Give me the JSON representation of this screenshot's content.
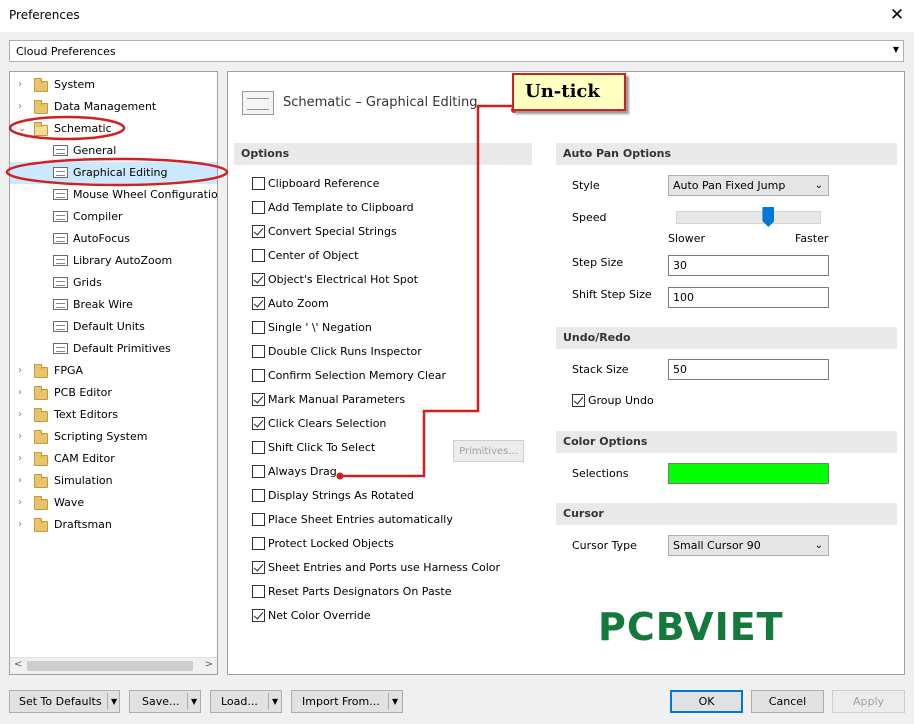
{
  "window": {
    "title": "Preferences",
    "close_glyph": "✕"
  },
  "cloud_combo": {
    "value": "Cloud Preferences"
  },
  "tree": {
    "items": [
      {
        "label": "System",
        "level": 0,
        "icon": "folder-icon",
        "expanded": false
      },
      {
        "label": "Data Management",
        "level": 0,
        "icon": "folder-icon",
        "expanded": false
      },
      {
        "label": "Schematic",
        "level": 0,
        "icon": "folder-open-icon",
        "expanded": true
      },
      {
        "label": "General",
        "level": 1,
        "icon": "page-icon"
      },
      {
        "label": "Graphical Editing",
        "level": 1,
        "icon": "page-icon",
        "selected": true
      },
      {
        "label": "Mouse Wheel Configuration",
        "level": 1,
        "icon": "page-icon"
      },
      {
        "label": "Compiler",
        "level": 1,
        "icon": "page-icon"
      },
      {
        "label": "AutoFocus",
        "level": 1,
        "icon": "page-icon"
      },
      {
        "label": "Library AutoZoom",
        "level": 1,
        "icon": "page-icon"
      },
      {
        "label": "Grids",
        "level": 1,
        "icon": "page-icon"
      },
      {
        "label": "Break Wire",
        "level": 1,
        "icon": "page-icon"
      },
      {
        "label": "Default Units",
        "level": 1,
        "icon": "page-icon"
      },
      {
        "label": "Default Primitives",
        "level": 1,
        "icon": "page-icon"
      },
      {
        "label": "FPGA",
        "level": 0,
        "icon": "folder-icon",
        "expanded": false
      },
      {
        "label": "PCB Editor",
        "level": 0,
        "icon": "folder-icon",
        "expanded": false
      },
      {
        "label": "Text Editors",
        "level": 0,
        "icon": "folder-icon",
        "expanded": false
      },
      {
        "label": "Scripting System",
        "level": 0,
        "icon": "folder-icon",
        "expanded": false
      },
      {
        "label": "CAM Editor",
        "level": 0,
        "icon": "folder-icon",
        "expanded": false
      },
      {
        "label": "Simulation",
        "level": 0,
        "icon": "folder-icon",
        "expanded": false
      },
      {
        "label": "Wave",
        "level": 0,
        "icon": "folder-icon",
        "expanded": false
      },
      {
        "label": "Draftsman",
        "level": 0,
        "icon": "folder-icon",
        "expanded": false
      }
    ]
  },
  "page": {
    "title": "Schematic – Graphical Editing",
    "icon": "schematic-page-icon"
  },
  "options": {
    "header": "Options",
    "items": [
      {
        "label": "Clipboard Reference",
        "checked": false
      },
      {
        "label": "Add Template to Clipboard",
        "checked": false
      },
      {
        "label": "Convert Special Strings",
        "checked": true
      },
      {
        "label": "Center of Object",
        "checked": false
      },
      {
        "label": "Object's Electrical Hot Spot",
        "checked": true
      },
      {
        "label": "Auto Zoom",
        "checked": true
      },
      {
        "label": "Single ' \\' Negation",
        "checked": false
      },
      {
        "label": "Double Click Runs Inspector",
        "checked": false
      },
      {
        "label": "Confirm Selection Memory Clear",
        "checked": false
      },
      {
        "label": "Mark Manual Parameters",
        "checked": true
      },
      {
        "label": "Click Clears Selection",
        "checked": true
      },
      {
        "label": "Shift Click To Select",
        "checked": false
      },
      {
        "label": "Always Drag",
        "checked": false
      },
      {
        "label": "Display Strings As Rotated",
        "checked": false
      },
      {
        "label": "Place Sheet Entries automatically",
        "checked": false
      },
      {
        "label": "Protect Locked Objects",
        "checked": false
      },
      {
        "label": "Sheet Entries and Ports use Harness Color",
        "checked": true
      },
      {
        "label": "Reset Parts Designators On Paste",
        "checked": false
      },
      {
        "label": "Net Color Override",
        "checked": true
      }
    ],
    "primitives_button": "Primitives..."
  },
  "auto_pan": {
    "header": "Auto Pan Options",
    "style_label": "Style",
    "style_value": "Auto Pan Fixed Jump",
    "speed_label": "Speed",
    "speed_level": 0.65,
    "slower_label": "Slower",
    "faster_label": "Faster",
    "step_size_label": "Step Size",
    "step_size_value": "30",
    "shift_step_label": "Shift Step Size",
    "shift_step_value": "100"
  },
  "undo_redo": {
    "header": "Undo/Redo",
    "stack_size_label": "Stack Size",
    "stack_size_value": "50",
    "group_undo_label": "Group Undo",
    "group_undo_checked": true
  },
  "color_options": {
    "header": "Color Options",
    "selections_label": "Selections",
    "selections_color": "#00ff00"
  },
  "cursor": {
    "header": "Cursor",
    "type_label": "Cursor Type",
    "type_value": "Small Cursor 90"
  },
  "footer": {
    "set_defaults": "Set To Defaults",
    "save": "Save...",
    "load": "Load...",
    "import_from": "Import From...",
    "ok": "OK",
    "cancel": "Cancel",
    "apply": "Apply"
  },
  "annotation": {
    "callout_text": "Un-tick",
    "color": "#d21f1f"
  },
  "watermark": {
    "text": "PCBVIET",
    "color": "#137a3c"
  }
}
